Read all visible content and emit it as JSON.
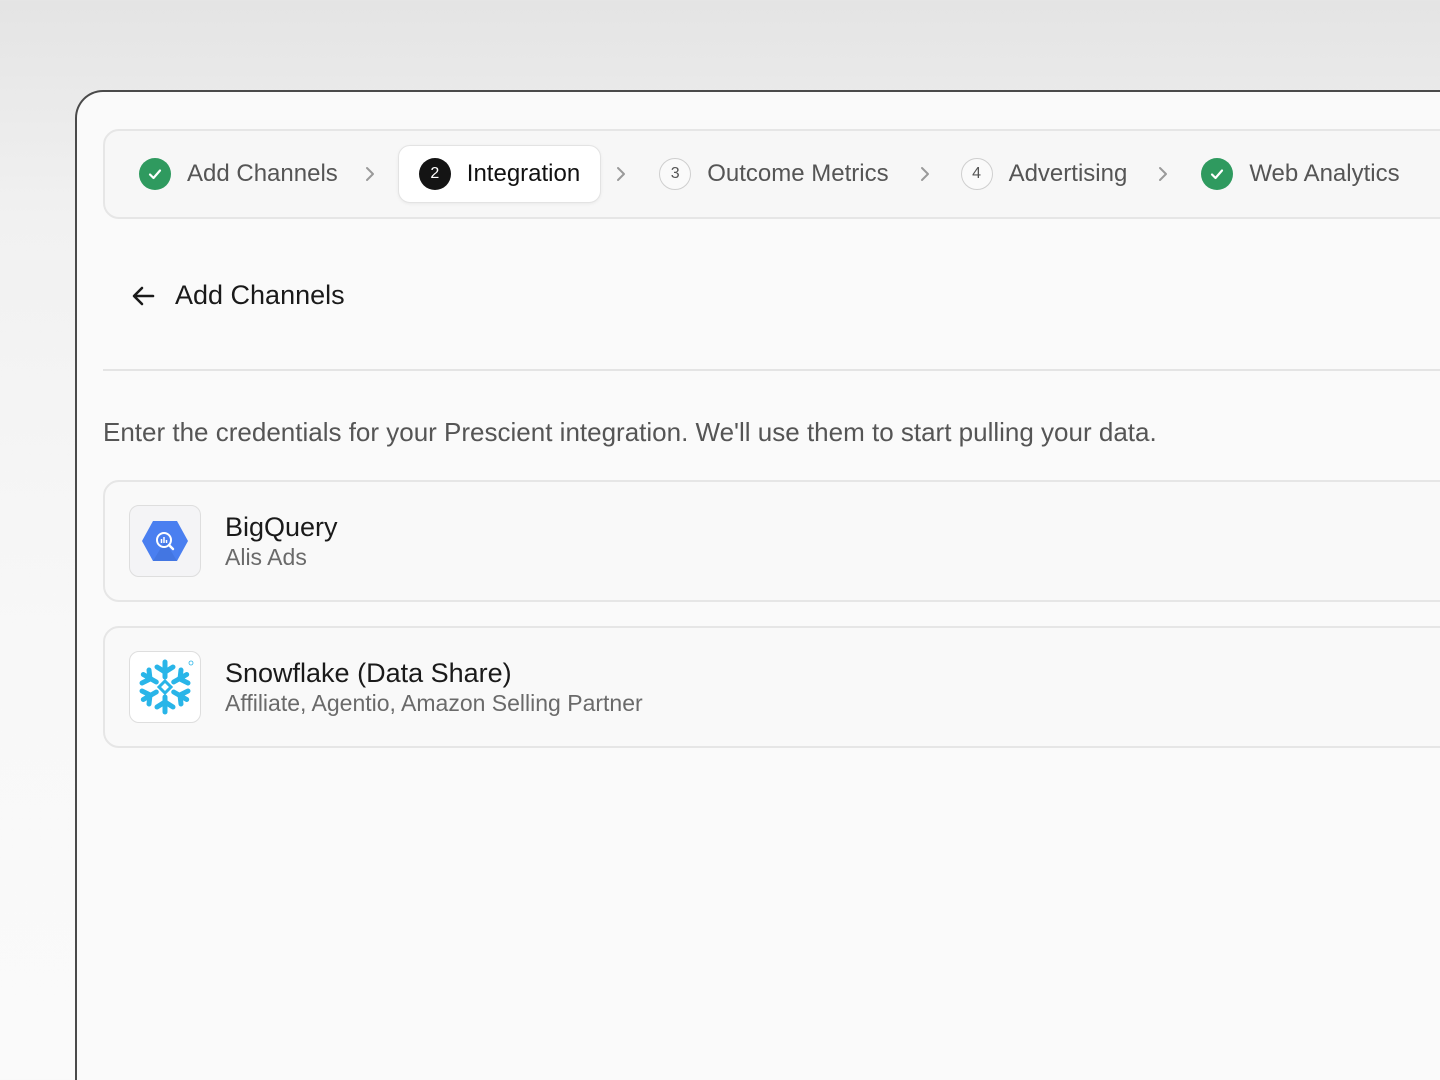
{
  "stepper": {
    "steps": [
      {
        "label": "Add Channels",
        "state": "complete"
      },
      {
        "label": "Integration",
        "number": "2",
        "state": "active"
      },
      {
        "label": "Outcome Metrics",
        "number": "3",
        "state": "pending"
      },
      {
        "label": "Advertising",
        "number": "4",
        "state": "pending"
      },
      {
        "label": "Web Analytics",
        "state": "complete"
      }
    ]
  },
  "header": {
    "back_label": "Add Channels"
  },
  "description": "Enter the credentials for your Prescient integration. We'll use them to start pulling your data.",
  "integrations": [
    {
      "title": "BigQuery",
      "subtitle": "Alis Ads",
      "icon": "bigquery-icon"
    },
    {
      "title": "Snowflake (Data Share)",
      "subtitle": "Affiliate, Agentio, Amazon Selling Partner",
      "icon": "snowflake-icon"
    }
  ],
  "colors": {
    "complete": "#2f9a5f",
    "active_badge": "#141414",
    "bigquery_blue": "#4a7ff0",
    "snowflake_blue": "#29b5e8"
  }
}
